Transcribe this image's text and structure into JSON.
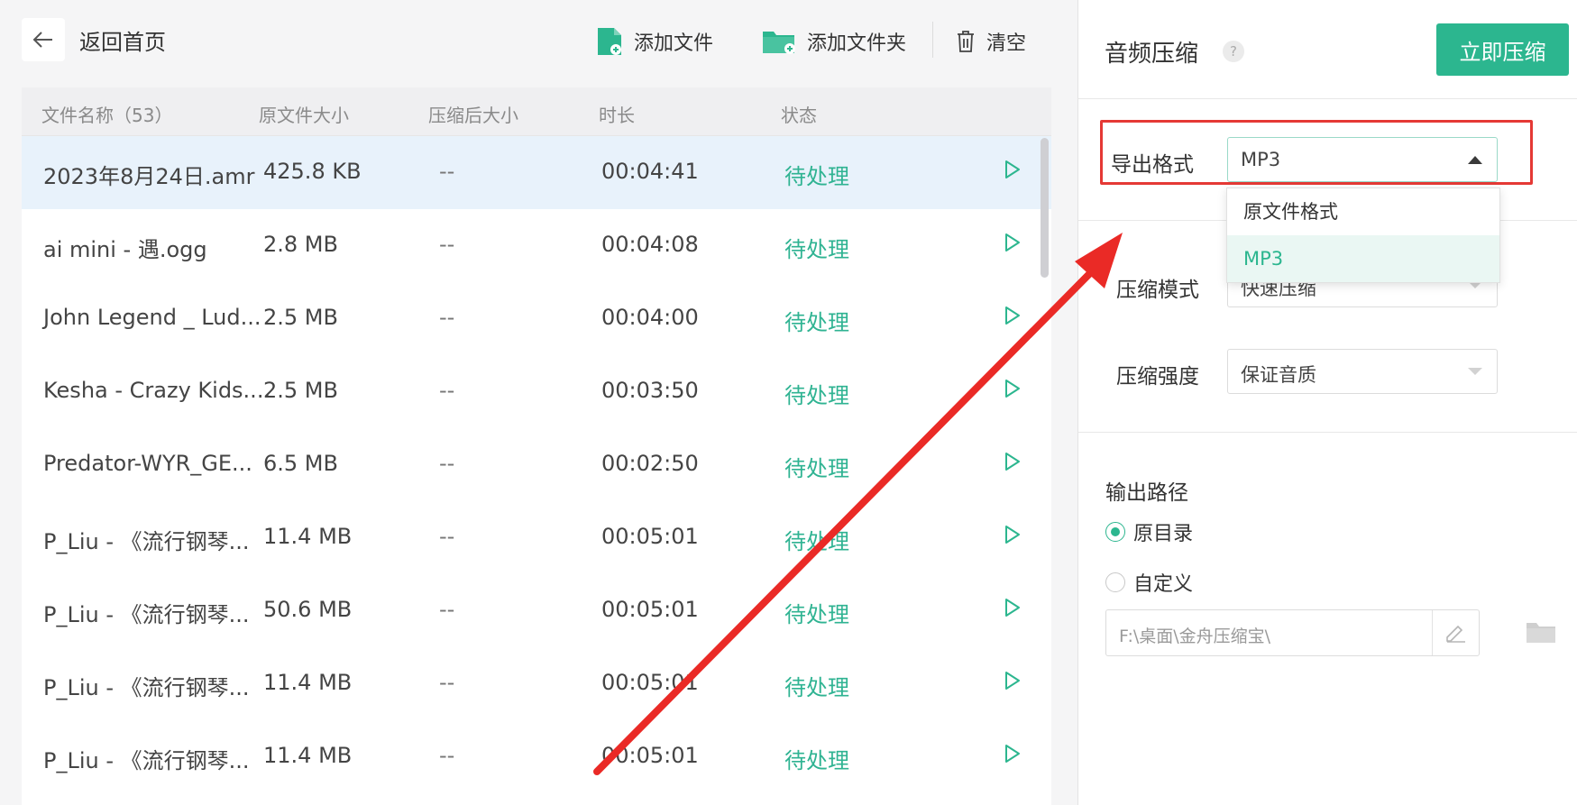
{
  "toolbar": {
    "back_label": "返回首页",
    "add_file": "添加文件",
    "add_folder": "添加文件夹",
    "clear": "清空"
  },
  "table": {
    "headers": {
      "name": "文件名称（53）",
      "orig_size": "原文件大小",
      "comp_size": "压缩后大小",
      "duration": "时长",
      "status": "状态"
    },
    "rows": [
      {
        "name": "2023年8月24日.amr",
        "orig": "425.8 KB",
        "comp": "--",
        "dur": "00:04:41",
        "status": "待处理"
      },
      {
        "name": "ai mini - 遇.ogg",
        "orig": "2.8 MB",
        "comp": "--",
        "dur": "00:04:08",
        "status": "待处理"
      },
      {
        "name": "John Legend _ Lud...",
        "orig": "2.5 MB",
        "comp": "--",
        "dur": "00:04:00",
        "status": "待处理"
      },
      {
        "name": "Kesha - Crazy Kids....",
        "orig": "2.5 MB",
        "comp": "--",
        "dur": "00:03:50",
        "status": "待处理"
      },
      {
        "name": "Predator-WYR_GE...",
        "orig": "6.5 MB",
        "comp": "--",
        "dur": "00:02:50",
        "status": "待处理"
      },
      {
        "name": "P_Liu - 《流行钢琴...",
        "orig": "11.4 MB",
        "comp": "--",
        "dur": "00:05:01",
        "status": "待处理"
      },
      {
        "name": "P_Liu - 《流行钢琴...",
        "orig": "50.6 MB",
        "comp": "--",
        "dur": "00:05:01",
        "status": "待处理"
      },
      {
        "name": "P_Liu - 《流行钢琴...",
        "orig": "11.4 MB",
        "comp": "--",
        "dur": "00:05:01",
        "status": "待处理"
      },
      {
        "name": "P_Liu - 《流行钢琴...",
        "orig": "11.4 MB",
        "comp": "--",
        "dur": "00:05:01",
        "status": "待处理"
      }
    ]
  },
  "settings": {
    "title": "音频压缩",
    "help": "?",
    "compress_button": "立即压缩",
    "format_label": "导出格式",
    "format_value": "MP3",
    "format_options": [
      "原文件格式",
      "MP3"
    ],
    "mode_label": "压缩模式",
    "mode_value": "快速压缩",
    "strength_label": "压缩强度",
    "strength_value": "保证音质",
    "output_label": "输出路径",
    "radio_original": "原目录",
    "radio_custom": "自定义",
    "path_value": "F:\\桌面\\金舟压缩宝\\"
  },
  "colors": {
    "accent": "#2cb68f",
    "annotation": "#e53935",
    "selected_row": "#e8f2fb"
  }
}
